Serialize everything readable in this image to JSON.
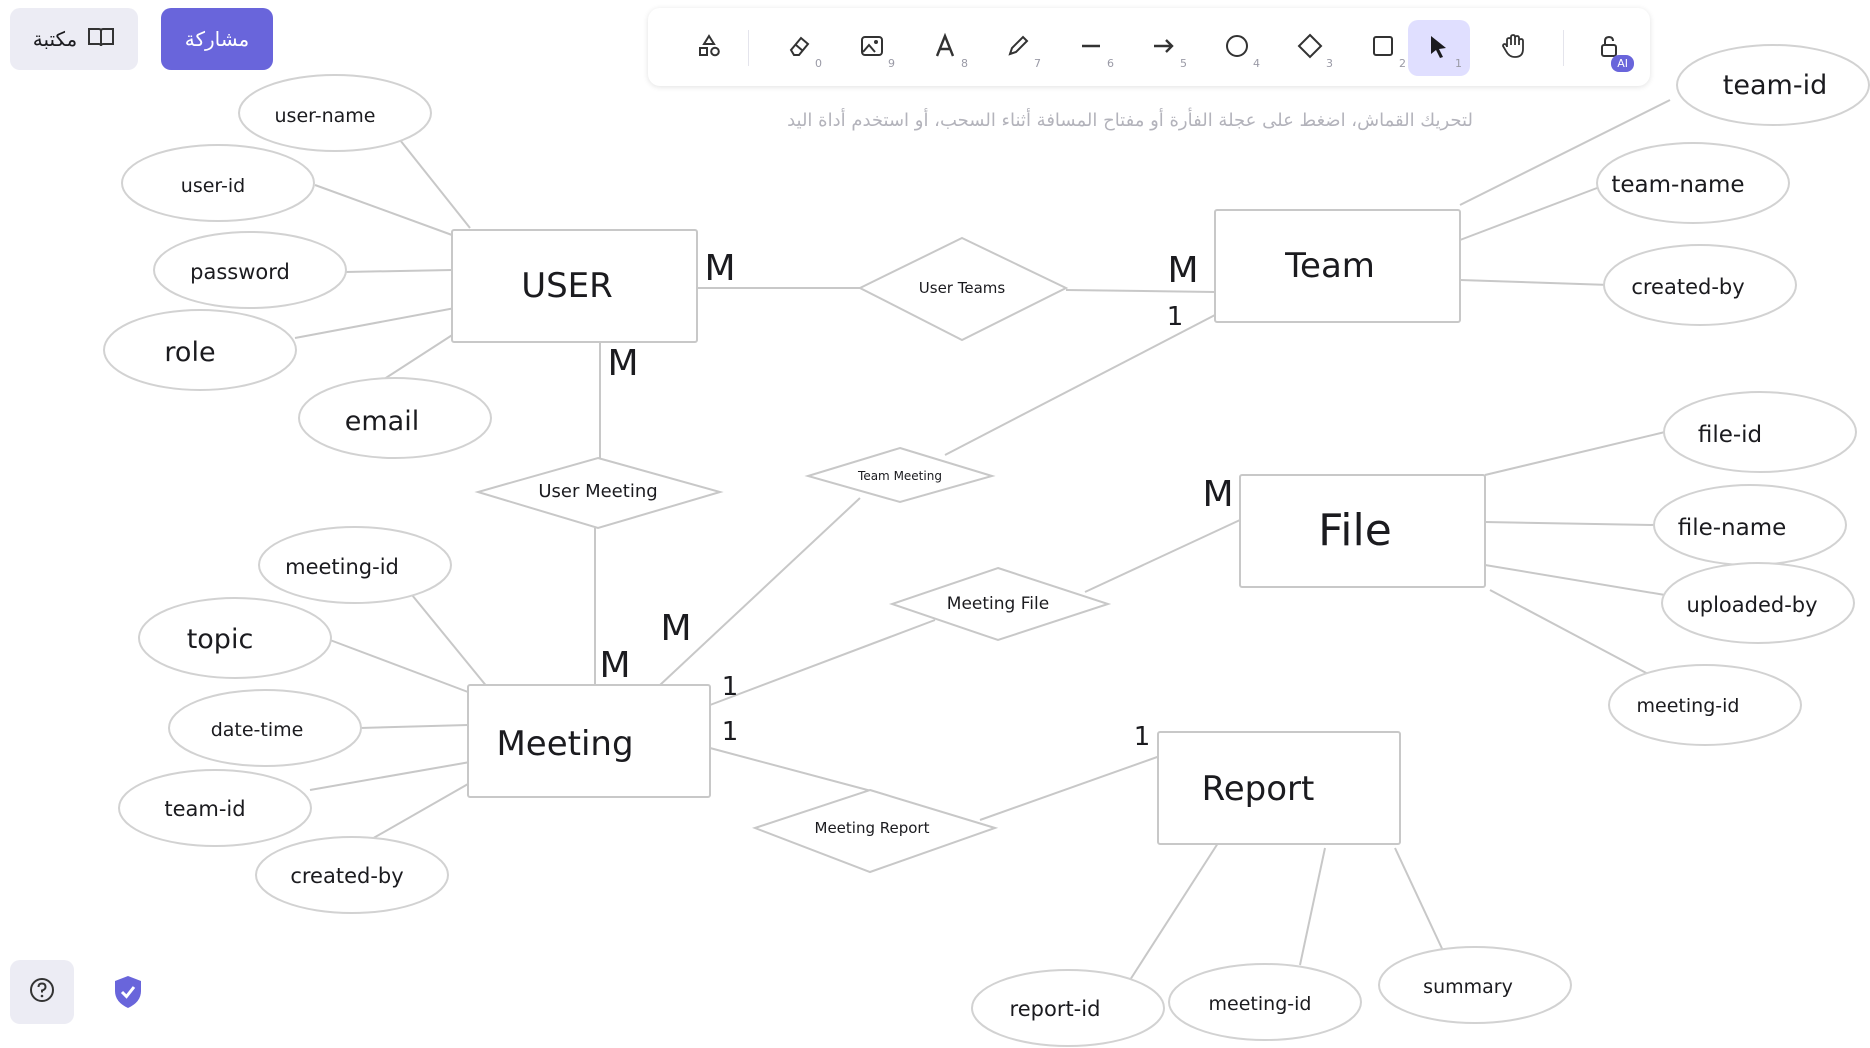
{
  "top_left": {
    "library_label": "مكتبة",
    "share_label": "مشاركة"
  },
  "toolbar": {
    "tools": [
      {
        "name": "shapes-tool",
        "icon": "shapes-icon",
        "key": ""
      },
      {
        "name": "eraser-tool",
        "icon": "eraser-icon",
        "key": "0"
      },
      {
        "name": "image-tool",
        "icon": "image-icon",
        "key": "9"
      },
      {
        "name": "text-tool",
        "icon": "text-icon",
        "key": "8"
      },
      {
        "name": "draw-tool",
        "icon": "pencil-icon",
        "key": "7"
      },
      {
        "name": "line-tool",
        "icon": "line-icon",
        "key": "6"
      },
      {
        "name": "arrow-tool",
        "icon": "arrow-icon",
        "key": "5"
      },
      {
        "name": "ellipse-tool",
        "icon": "circle-icon",
        "key": "4"
      },
      {
        "name": "diamond-tool",
        "icon": "diamond-icon",
        "key": "3"
      },
      {
        "name": "rectangle-tool",
        "icon": "square-icon",
        "key": "2"
      },
      {
        "name": "selection-tool",
        "icon": "cursor-icon",
        "key": "1",
        "active": true
      },
      {
        "name": "hand-tool",
        "icon": "hand-icon",
        "key": ""
      },
      {
        "name": "lock-tool",
        "icon": "lock-icon",
        "key": "",
        "badge": "AI"
      }
    ],
    "hint": "لتحريك القماش، اضغط على عجلة الفأرة أو مفتاح المسافة أثناء السحب، أو استخدم أداة اليد"
  },
  "diagram": {
    "entities": [
      {
        "id": "user",
        "label": "USER"
      },
      {
        "id": "team",
        "label": "Team"
      },
      {
        "id": "file",
        "label": "File"
      },
      {
        "id": "meeting",
        "label": "Meeting"
      },
      {
        "id": "report",
        "label": "Report"
      }
    ],
    "relationships": [
      {
        "id": "user_team",
        "label": "User Teams"
      },
      {
        "id": "user_meeting",
        "label": "User Meeting"
      },
      {
        "id": "team_meeting",
        "label": "Team Meeting"
      },
      {
        "id": "meeting_file",
        "label": "Meeting File"
      },
      {
        "id": "meeting_report",
        "label": "Meeting Report"
      }
    ],
    "attributes": {
      "user": [
        "user-name",
        "user-id",
        "password",
        "role",
        "email"
      ],
      "team": [
        "team-id",
        "team-name",
        "created-by"
      ],
      "file": [
        "file-id",
        "file-name",
        "uploaded-by",
        "meeting-id"
      ],
      "meeting": [
        "meeting-id",
        "topic",
        "date-time",
        "team-id",
        "created-by"
      ],
      "report": [
        "report-id",
        "meeting-id",
        "summary"
      ]
    },
    "cardinalities": [
      "M",
      "M",
      "1",
      "M",
      "M",
      "M",
      "1",
      "1",
      "M",
      "1"
    ]
  },
  "colors": {
    "accent": "#6965db",
    "accent_light": "#e0dfff",
    "stroke": "#c8c8c8",
    "ink": "#1b1b1f"
  }
}
